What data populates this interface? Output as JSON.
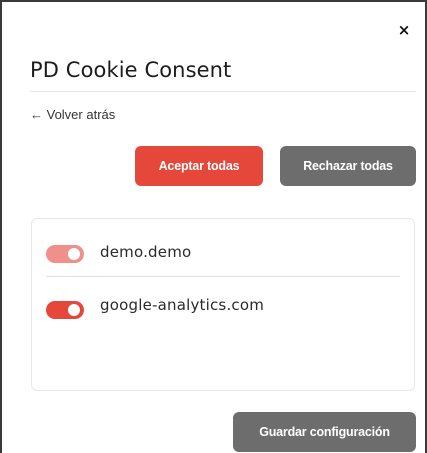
{
  "dialog": {
    "close_symbol": "×",
    "title": "PD Cookie Consent",
    "back_link": "← Volver atrás",
    "buttons": {
      "accept_all": "Aceptar todas",
      "reject_all": "Rechazar todas",
      "save_settings": "Guardar configuración"
    },
    "domains": [
      {
        "name": "demo.demo",
        "enabled": true
      },
      {
        "name": "google-analytics.com",
        "enabled": true
      }
    ]
  },
  "colors": {
    "accent": "#e5483a",
    "accent_light": "#f0908a",
    "secondary_button": "#6d6d6d",
    "panel_border": "#e7e7e7"
  },
  "icons": {
    "close": "close-icon",
    "back_arrow": "arrow-left-icon"
  }
}
